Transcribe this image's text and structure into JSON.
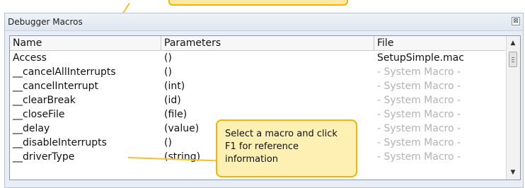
{
  "panel": {
    "title": "Debugger Macros",
    "close_glyph": "⊠"
  },
  "columns": [
    "Name",
    "Parameters",
    "File"
  ],
  "rows": [
    {
      "name": "Access",
      "params": "()",
      "file": "SetupSimple.mac",
      "system": false
    },
    {
      "name": "__cancelAllInterrupts",
      "params": "()",
      "file": "- System Macro -",
      "system": true
    },
    {
      "name": "__cancelInterrupt",
      "params": "(int)",
      "file": "- System Macro -",
      "system": true
    },
    {
      "name": "__clearBreak",
      "params": "(id)",
      "file": "- System Macro -",
      "system": true
    },
    {
      "name": "__closeFile",
      "params": "(file)",
      "file": "- System Macro -",
      "system": true
    },
    {
      "name": "__delay",
      "params": "(value)",
      "file": "- System Macro -",
      "system": true
    },
    {
      "name": "__disableInterrupts",
      "params": "()",
      "file": "- System Macro -",
      "system": true
    },
    {
      "name": "__driverType",
      "params": "(string)",
      "file": "- System Macro -",
      "system": true
    }
  ],
  "callout": {
    "text": "Select a macro and click F1 for reference information"
  },
  "scrollbar": {
    "up": "▲",
    "down": "▼"
  },
  "colors": {
    "callout_fill": "#fdf0b2",
    "callout_border": "#f2b600",
    "system_text": "#b3b3b3"
  }
}
